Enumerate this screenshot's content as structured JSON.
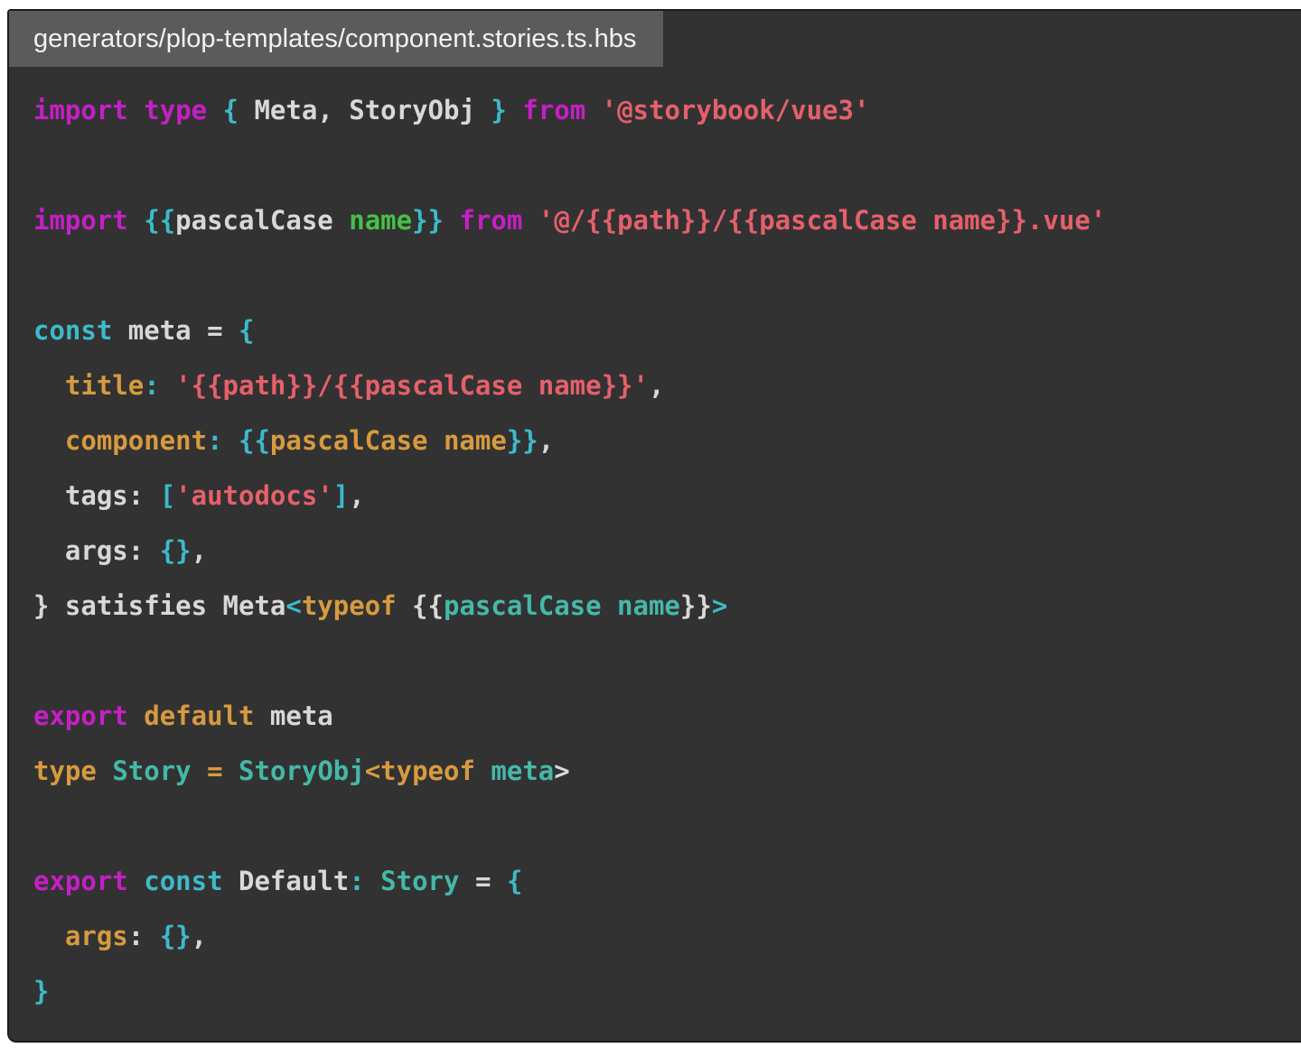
{
  "tab": {
    "filename": "generators/plop-templates/component.stories.ts.hbs"
  },
  "colors": {
    "background": "#323232",
    "border": "#1c1c1c",
    "tab_background": "#5b5b5b",
    "tab_text": "#f2f2f2",
    "magenta": "#c51fc5",
    "cyan": "#3dbac9",
    "teal": "#45b8a8",
    "white": "#d8d8d8",
    "orange": "#d79a3f",
    "red": "#e5606b",
    "green": "#47c047"
  },
  "code": {
    "language": "typescript-handlebars",
    "plain_text": "import type { Meta, StoryObj } from '@storybook/vue3'\n\nimport {{pascalCase name}} from '@/{{path}}/{{pascalCase name}}.vue'\n\nconst meta = {\n  title: '{{path}}/{{pascalCase name}}',\n  component: {{pascalCase name}},\n  tags: ['autodocs'],\n  args: {},\n} satisfies Meta<typeof {{pascalCase name}}>\n\nexport default meta\ntype Story = StoryObj<typeof meta>\n\nexport const Default: Story = {\n  args: {},\n}",
    "lines": [
      [
        {
          "t": "import",
          "c": "magenta"
        },
        {
          "t": " "
        },
        {
          "t": "type",
          "c": "magenta"
        },
        {
          "t": " "
        },
        {
          "t": "{",
          "c": "cyan"
        },
        {
          "t": " Meta, StoryObj "
        },
        {
          "t": "}",
          "c": "cyan"
        },
        {
          "t": " "
        },
        {
          "t": "from",
          "c": "magenta"
        },
        {
          "t": " "
        },
        {
          "t": "'@storybook/vue3'",
          "c": "red"
        }
      ],
      [],
      [
        {
          "t": "import",
          "c": "magenta"
        },
        {
          "t": " "
        },
        {
          "t": "{{",
          "c": "cyan"
        },
        {
          "t": "pascalCase"
        },
        {
          "t": " "
        },
        {
          "t": "name",
          "c": "green"
        },
        {
          "t": "}}",
          "c": "cyan"
        },
        {
          "t": " "
        },
        {
          "t": "from",
          "c": "magenta"
        },
        {
          "t": " "
        },
        {
          "t": "'@/{{path}}/{{pascalCase name}}.vue'",
          "c": "red"
        }
      ],
      [],
      [
        {
          "t": "const",
          "c": "cyan"
        },
        {
          "t": " meta = "
        },
        {
          "t": "{",
          "c": "cyan"
        }
      ],
      [
        {
          "t": "  "
        },
        {
          "t": "title",
          "c": "orange"
        },
        {
          "t": ":",
          "c": "cyan"
        },
        {
          "t": " "
        },
        {
          "t": "'{{path}}/{{pascalCase name}}'",
          "c": "red"
        },
        {
          "t": ","
        }
      ],
      [
        {
          "t": "  "
        },
        {
          "t": "component",
          "c": "orange"
        },
        {
          "t": ":",
          "c": "cyan"
        },
        {
          "t": " "
        },
        {
          "t": "{{",
          "c": "cyan"
        },
        {
          "t": "pascalCase name",
          "c": "orange"
        },
        {
          "t": "}}",
          "c": "cyan"
        },
        {
          "t": ","
        }
      ],
      [
        {
          "t": "  tags: "
        },
        {
          "t": "[",
          "c": "cyan"
        },
        {
          "t": "'autodocs'",
          "c": "red"
        },
        {
          "t": "]",
          "c": "cyan"
        },
        {
          "t": ","
        }
      ],
      [
        {
          "t": "  args: "
        },
        {
          "t": "{}",
          "c": "cyan"
        },
        {
          "t": ","
        }
      ],
      [
        {
          "t": "} satisfies Meta"
        },
        {
          "t": "<",
          "c": "cyan"
        },
        {
          "t": "typeof",
          "c": "orange"
        },
        {
          "t": " {{"
        },
        {
          "t": "pascalCase name",
          "c": "teal"
        },
        {
          "t": "}}"
        },
        {
          "t": ">",
          "c": "cyan"
        }
      ],
      [],
      [
        {
          "t": "export",
          "c": "magenta"
        },
        {
          "t": " "
        },
        {
          "t": "default",
          "c": "orange"
        },
        {
          "t": " meta"
        }
      ],
      [
        {
          "t": "type",
          "c": "orange"
        },
        {
          "t": " "
        },
        {
          "t": "Story",
          "c": "teal"
        },
        {
          "t": " "
        },
        {
          "t": "=",
          "c": "orange"
        },
        {
          "t": " "
        },
        {
          "t": "StoryObj",
          "c": "teal"
        },
        {
          "t": "<typeof",
          "c": "orange"
        },
        {
          "t": " "
        },
        {
          "t": "meta",
          "c": "teal"
        },
        {
          "t": ">"
        }
      ],
      [],
      [
        {
          "t": "export",
          "c": "magenta"
        },
        {
          "t": " "
        },
        {
          "t": "const",
          "c": "cyan"
        },
        {
          "t": " Default"
        },
        {
          "t": ":",
          "c": "cyan"
        },
        {
          "t": " "
        },
        {
          "t": "Story",
          "c": "teal"
        },
        {
          "t": " = "
        },
        {
          "t": "{",
          "c": "cyan"
        }
      ],
      [
        {
          "t": "  "
        },
        {
          "t": "args",
          "c": "orange"
        },
        {
          "t": ": "
        },
        {
          "t": "{}",
          "c": "cyan"
        },
        {
          "t": ","
        }
      ],
      [
        {
          "t": "}",
          "c": "cyan"
        }
      ]
    ]
  }
}
